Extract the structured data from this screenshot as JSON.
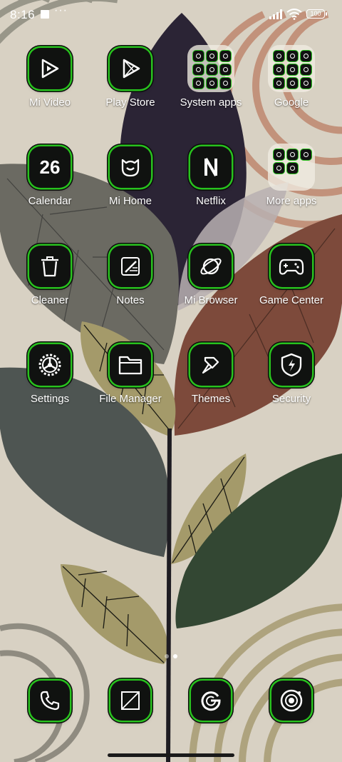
{
  "status_bar": {
    "time": "8:16",
    "more": "···",
    "battery": "100"
  },
  "colors": {
    "accent": "#28c21e",
    "tile_bg": "#101210"
  },
  "apps": [
    {
      "label": "Mi Video",
      "icon": "play-triangle-icon"
    },
    {
      "label": "Play Store",
      "icon": "play-store-icon"
    },
    {
      "label": "System apps",
      "icon": "folder-icon"
    },
    {
      "label": "Google",
      "icon": "folder-icon"
    },
    {
      "label": "Calendar",
      "icon": "calendar-icon",
      "badge": "26"
    },
    {
      "label": "Mi Home",
      "icon": "mi-home-icon"
    },
    {
      "label": "Netflix",
      "icon": "netflix-icon"
    },
    {
      "label": "More apps",
      "icon": "folder-icon"
    },
    {
      "label": "Cleaner",
      "icon": "trash-icon"
    },
    {
      "label": "Notes",
      "icon": "notes-icon"
    },
    {
      "label": "Mi Browser",
      "icon": "planet-icon"
    },
    {
      "label": "Game Center",
      "icon": "gamepad-icon"
    },
    {
      "label": "Settings",
      "icon": "gear-icon"
    },
    {
      "label": "File Manager",
      "icon": "folder-file-icon"
    },
    {
      "label": "Themes",
      "icon": "brush-icon"
    },
    {
      "label": "Security",
      "icon": "shield-icon"
    }
  ],
  "dock": [
    {
      "icon": "phone-icon"
    },
    {
      "icon": "messages-icon"
    },
    {
      "icon": "google-icon"
    },
    {
      "icon": "camera-icon"
    }
  ],
  "pages": {
    "count": 2,
    "current": 2
  }
}
